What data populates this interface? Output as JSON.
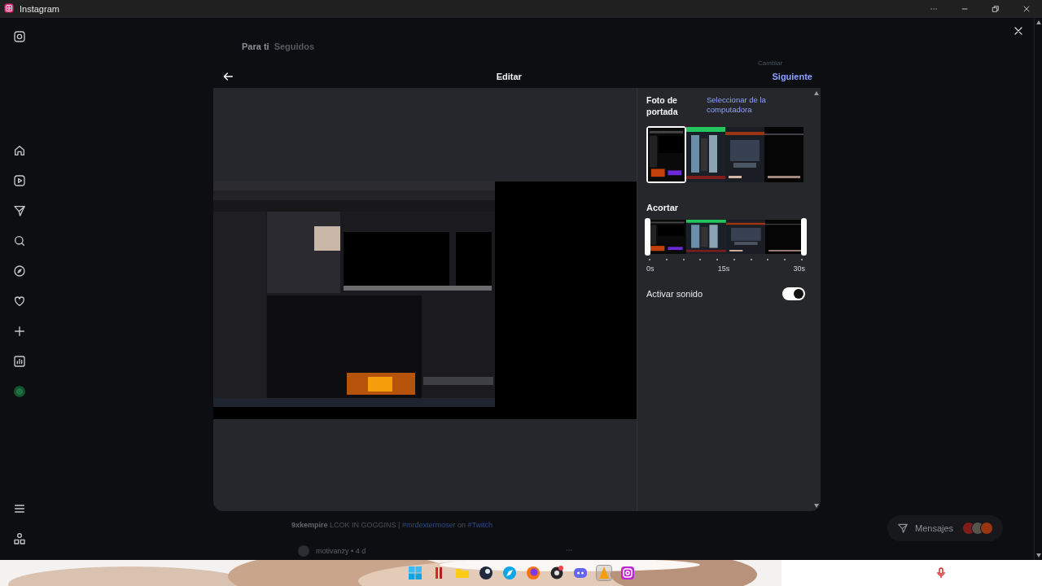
{
  "window": {
    "title": "Instagram"
  },
  "feed": {
    "tabs": [
      {
        "label": "Para ti",
        "selected": true
      },
      {
        "label": "Seguidos",
        "selected": false
      }
    ],
    "suggestion_action": "Cambiar",
    "caption": {
      "author": "9xkempire",
      "parts": [
        {
          "kind": "text",
          "text": "LCOK IN GOGGINS |"
        },
        {
          "kind": "tag",
          "text": "#mrdextermoser"
        },
        {
          "kind": "text",
          "text": "on"
        },
        {
          "kind": "tag",
          "text": "#Twitch"
        }
      ]
    },
    "next_post": {
      "author": "motivanzy",
      "age": "• 4 d"
    }
  },
  "messages": {
    "label": "Mensajes"
  },
  "modal": {
    "title": "Editar",
    "next": "Siguiente",
    "cover": {
      "label": "Foto de portada",
      "link": "Seleccionar de la computadora",
      "frames": [
        {
          "selected": true
        },
        {
          "selected": false
        },
        {
          "selected": false
        },
        {
          "selected": false
        }
      ]
    },
    "trim": {
      "label": "Acortar",
      "ticks": [
        "0s",
        "15s",
        "30s"
      ]
    },
    "sound": {
      "label": "Activar sonido",
      "on": true
    }
  }
}
